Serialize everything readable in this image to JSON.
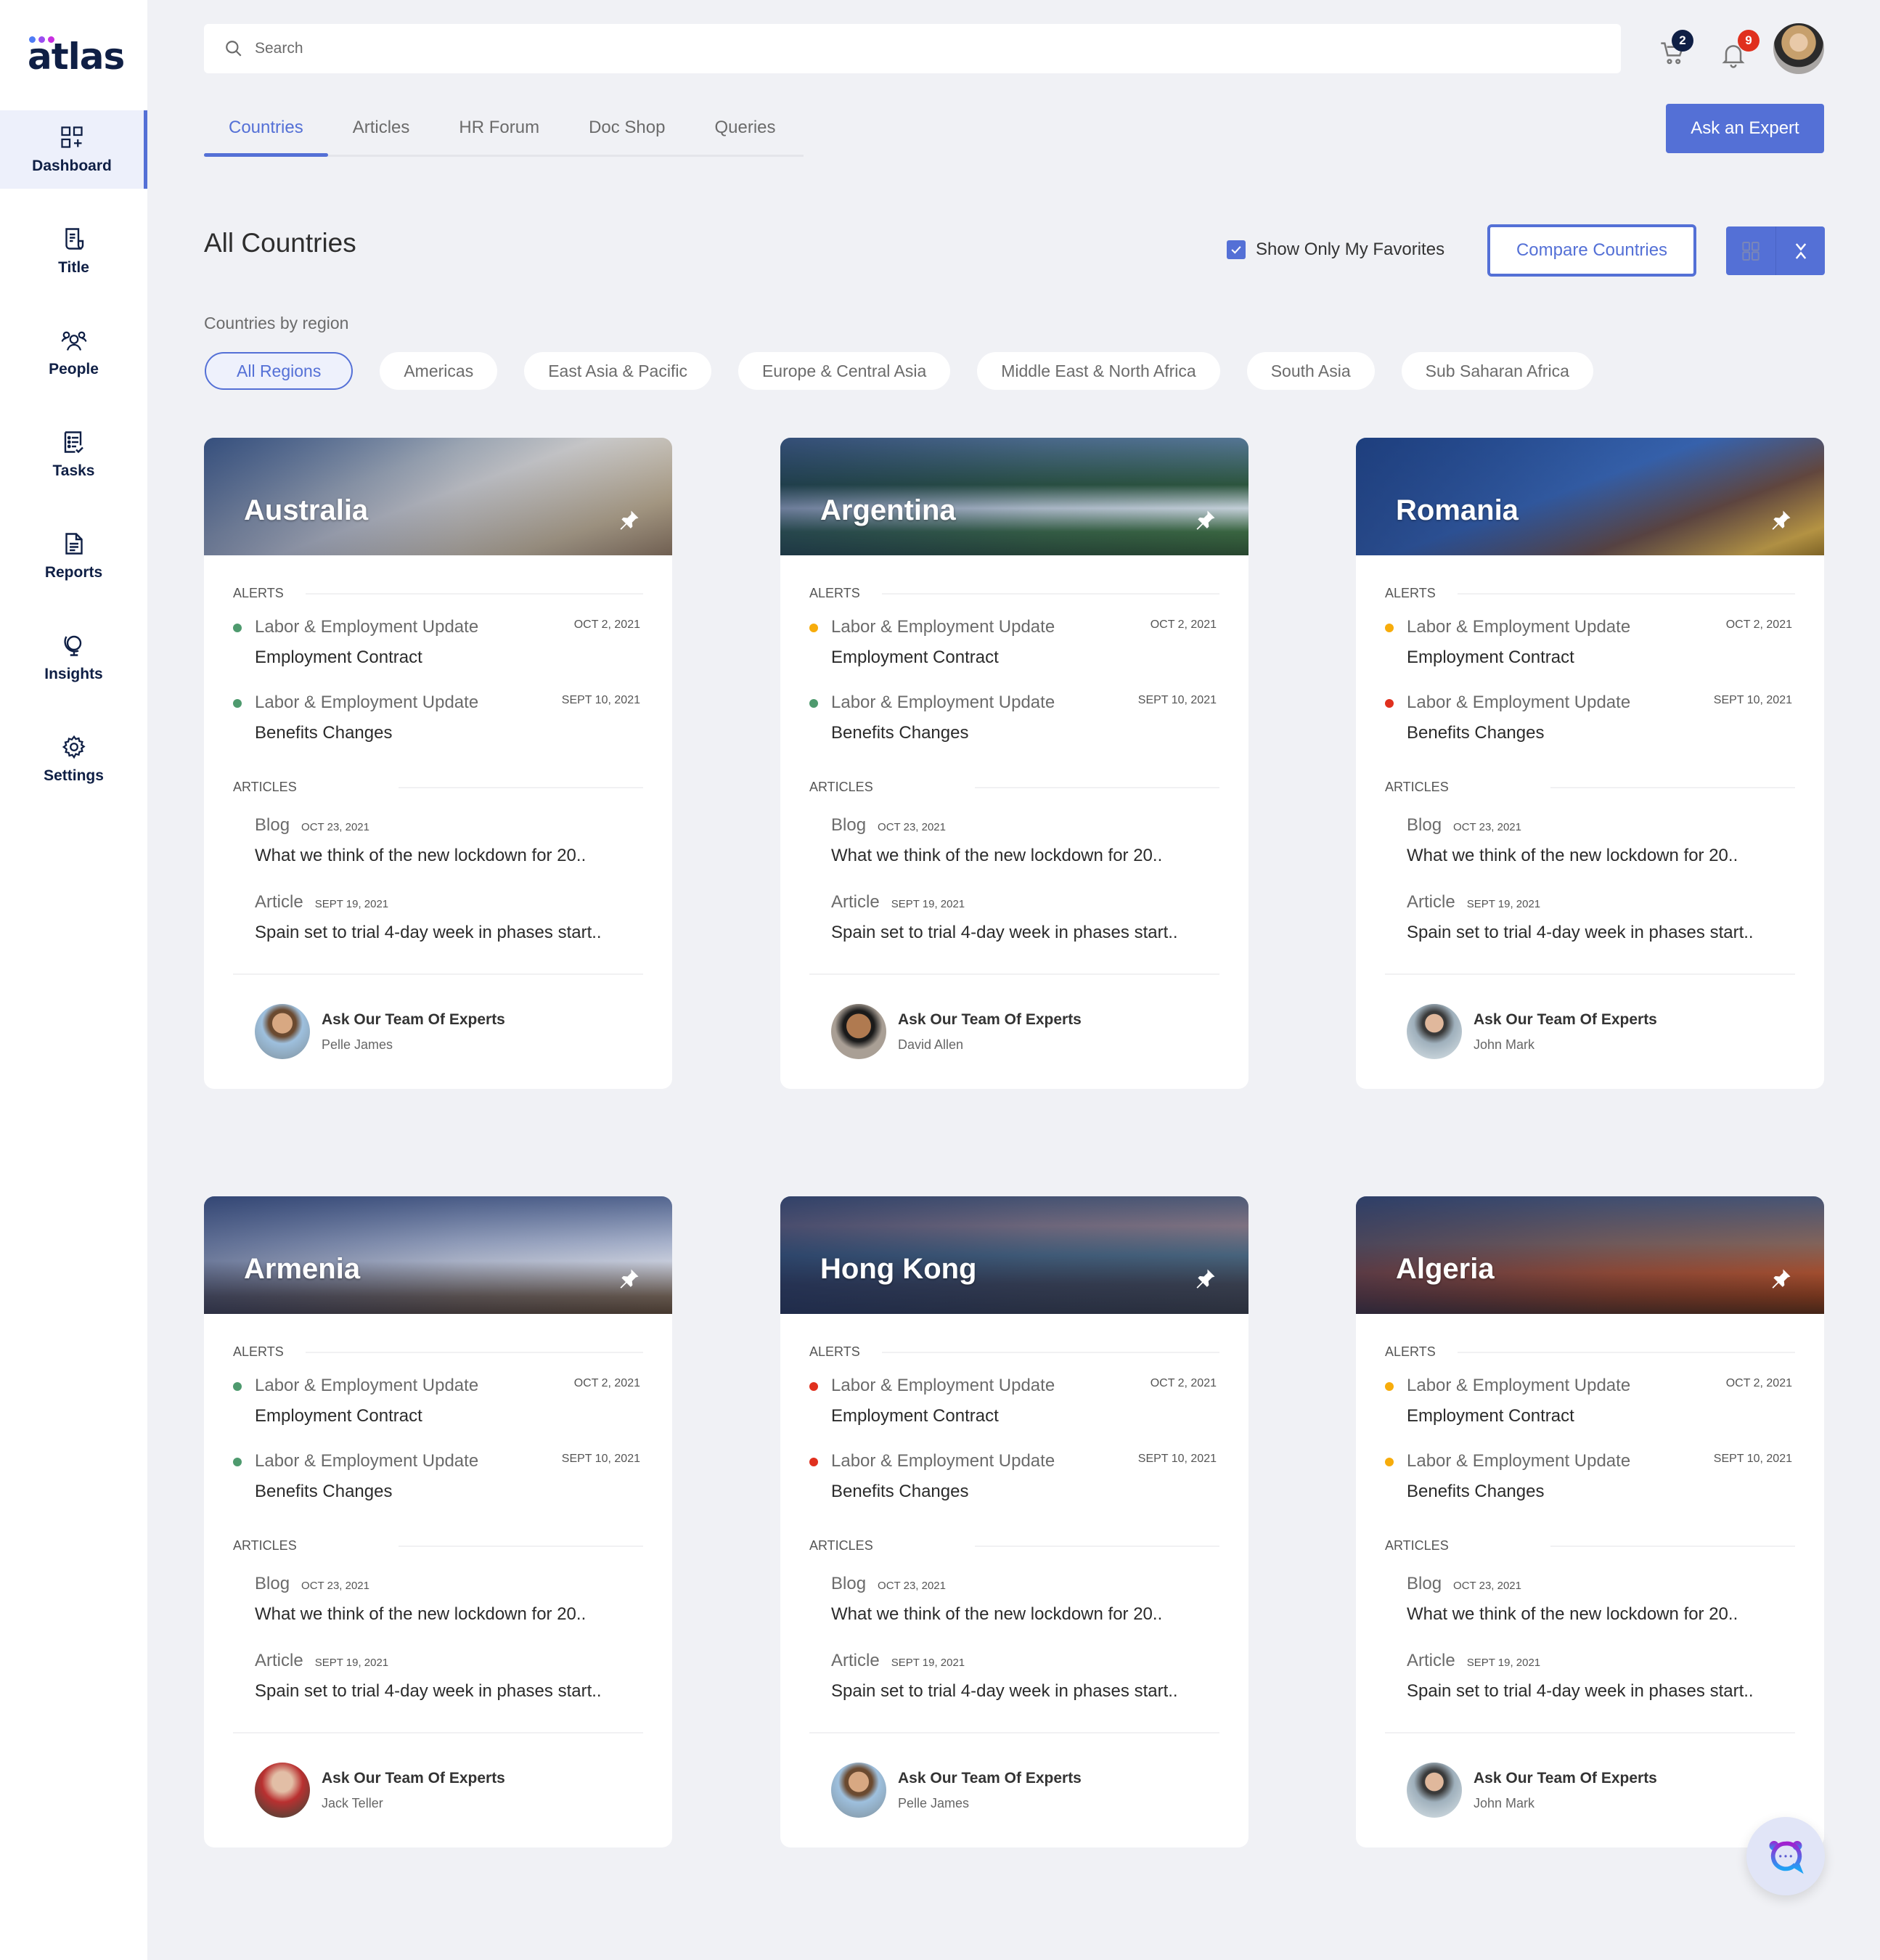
{
  "app": {
    "logo_text": "atlas",
    "logo_dot_colors": [
      "#4f7cf5",
      "#9b4df0",
      "#c92ee0"
    ]
  },
  "sidebar": {
    "items": [
      {
        "label": "Dashboard",
        "icon": "dashboard-icon",
        "active": true
      },
      {
        "label": "Title",
        "icon": "title-document-icon",
        "active": false
      },
      {
        "label": "People",
        "icon": "people-icon",
        "active": false
      },
      {
        "label": "Tasks",
        "icon": "tasks-icon",
        "active": false
      },
      {
        "label": "Reports",
        "icon": "reports-icon",
        "active": false
      },
      {
        "label": "Insights",
        "icon": "insights-globe-icon",
        "active": false
      },
      {
        "label": "Settings",
        "icon": "gear-icon",
        "active": false
      }
    ]
  },
  "header": {
    "search_placeholder": "Search",
    "cart_count": "2",
    "notification_count": "9",
    "ask_expert_label": "Ask an Expert"
  },
  "tabs": [
    {
      "label": "Countries",
      "active": true
    },
    {
      "label": "Articles",
      "active": false
    },
    {
      "label": "HR Forum",
      "active": false
    },
    {
      "label": "Doc Shop",
      "active": false
    },
    {
      "label": "Queries",
      "active": false
    }
  ],
  "toolbar": {
    "page_title": "All Countries",
    "favorites_label": "Show Only My Favorites",
    "favorites_checked": true,
    "compare_label": "Compare Countries"
  },
  "regions": {
    "label": "Countries by region",
    "options": [
      "All Regions",
      "Americas",
      "East Asia & Pacific",
      "Europe & Central Asia",
      "Middle East & North Africa",
      "South Asia",
      "Sub Saharan Africa"
    ],
    "selected": "All Regions"
  },
  "status_colors": {
    "green": "#4e9a6e",
    "amber": "#f7ac0b",
    "red": "#e0301e"
  },
  "section_labels": {
    "alerts": "ALERTS",
    "articles": "ARTICLES",
    "expert_cta": "Ask Our Team Of Experts"
  },
  "countries": [
    {
      "name": "Australia",
      "alerts": [
        {
          "type": "Labor & Employment Update",
          "title": "Employment Contract",
          "date": "OCT 2, 2021",
          "status": "green"
        },
        {
          "type": "Labor & Employment Update",
          "title": "Benefits Changes",
          "date": "SEPT 10, 2021",
          "status": "green"
        }
      ],
      "articles": [
        {
          "kind": "Blog",
          "date": "OCT 23, 2021",
          "title": "What we think of the new lockdown for 20.."
        },
        {
          "kind": "Article",
          "date": "SEPT 19, 2021",
          "title": "Spain set to trial 4-day week in phases start.."
        }
      ],
      "expert": "Pelle James"
    },
    {
      "name": "Argentina",
      "alerts": [
        {
          "type": "Labor & Employment Update",
          "title": "Employment Contract",
          "date": "OCT 2, 2021",
          "status": "amber"
        },
        {
          "type": "Labor & Employment Update",
          "title": "Benefits Changes",
          "date": "SEPT 10, 2021",
          "status": "green"
        }
      ],
      "articles": [
        {
          "kind": "Blog",
          "date": "OCT 23, 2021",
          "title": "What we think of the new lockdown for 20.."
        },
        {
          "kind": "Article",
          "date": "SEPT 19, 2021",
          "title": "Spain set to trial 4-day week in phases start.."
        }
      ],
      "expert": "David Allen"
    },
    {
      "name": "Romania",
      "alerts": [
        {
          "type": "Labor & Employment Update",
          "title": "Employment Contract",
          "date": "OCT 2, 2021",
          "status": "amber"
        },
        {
          "type": "Labor & Employment Update",
          "title": "Benefits Changes",
          "date": "SEPT 10, 2021",
          "status": "red"
        }
      ],
      "articles": [
        {
          "kind": "Blog",
          "date": "OCT 23, 2021",
          "title": "What we think of the new lockdown for 20.."
        },
        {
          "kind": "Article",
          "date": "SEPT 19, 2021",
          "title": "Spain set to trial 4-day week in phases start.."
        }
      ],
      "expert": "John Mark"
    },
    {
      "name": "Armenia",
      "alerts": [
        {
          "type": "Labor & Employment Update",
          "title": "Employment Contract",
          "date": "OCT 2, 2021",
          "status": "green"
        },
        {
          "type": "Labor & Employment Update",
          "title": "Benefits Changes",
          "date": "SEPT 10, 2021",
          "status": "green"
        }
      ],
      "articles": [
        {
          "kind": "Blog",
          "date": "OCT 23, 2021",
          "title": "What we think of the new lockdown for 20.."
        },
        {
          "kind": "Article",
          "date": "SEPT 19, 2021",
          "title": "Spain set to trial 4-day week in phases start.."
        }
      ],
      "expert": "Jack Teller"
    },
    {
      "name": "Hong Kong",
      "alerts": [
        {
          "type": "Labor & Employment Update",
          "title": "Employment Contract",
          "date": "OCT 2, 2021",
          "status": "red"
        },
        {
          "type": "Labor & Employment Update",
          "title": "Benefits Changes",
          "date": "SEPT 10, 2021",
          "status": "red"
        }
      ],
      "articles": [
        {
          "kind": "Blog",
          "date": "OCT 23, 2021",
          "title": "What we think of the new lockdown for 20.."
        },
        {
          "kind": "Article",
          "date": "SEPT 19, 2021",
          "title": "Spain set to trial 4-day week in phases start.."
        }
      ],
      "expert": "Pelle James"
    },
    {
      "name": "Algeria",
      "alerts": [
        {
          "type": "Labor & Employment Update",
          "title": "Employment Contract",
          "date": "OCT 2, 2021",
          "status": "amber"
        },
        {
          "type": "Labor & Employment Update",
          "title": "Benefits Changes",
          "date": "SEPT 10, 2021",
          "status": "amber"
        }
      ],
      "articles": [
        {
          "kind": "Blog",
          "date": "OCT 23, 2021",
          "title": "What we think of the new lockdown for 20.."
        },
        {
          "kind": "Article",
          "date": "SEPT 19, 2021",
          "title": "Spain set to trial 4-day week in phases start.."
        }
      ],
      "expert": "John Mark"
    }
  ]
}
